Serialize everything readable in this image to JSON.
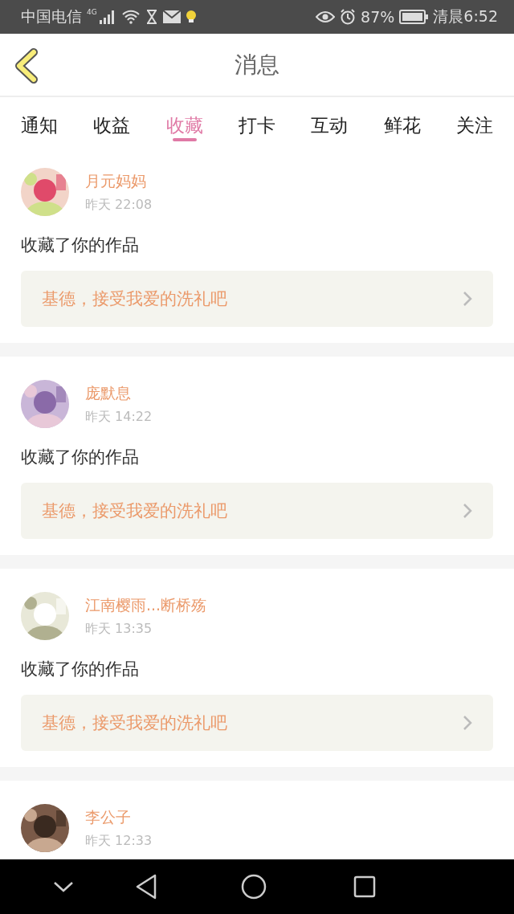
{
  "status_bar": {
    "carrier": "中国电信",
    "network": "4G",
    "battery": "87%",
    "time": "清晨6:52"
  },
  "header": {
    "title": "消息"
  },
  "tabs": [
    {
      "label": "通知",
      "selected": false
    },
    {
      "label": "收益",
      "selected": false
    },
    {
      "label": "收藏",
      "selected": true
    },
    {
      "label": "打卡",
      "selected": false
    },
    {
      "label": "互动",
      "selected": false
    },
    {
      "label": "鲜花",
      "selected": false
    },
    {
      "label": "关注",
      "selected": false
    }
  ],
  "messages": [
    {
      "user": "月元妈妈",
      "time": "昨天 22:08",
      "action": "收藏了你的作品",
      "work": "基德，接受我爱的洗礼吧"
    },
    {
      "user": "庞默息",
      "time": "昨天 14:22",
      "action": "收藏了你的作品",
      "work": "基德，接受我爱的洗礼吧"
    },
    {
      "user": "江南樱雨...断桥殇",
      "time": "昨天 13:35",
      "action": "收藏了你的作品",
      "work": "基德，接受我爱的洗礼吧"
    },
    {
      "user": "李公子",
      "time": "昨天 12:33"
    }
  ]
}
